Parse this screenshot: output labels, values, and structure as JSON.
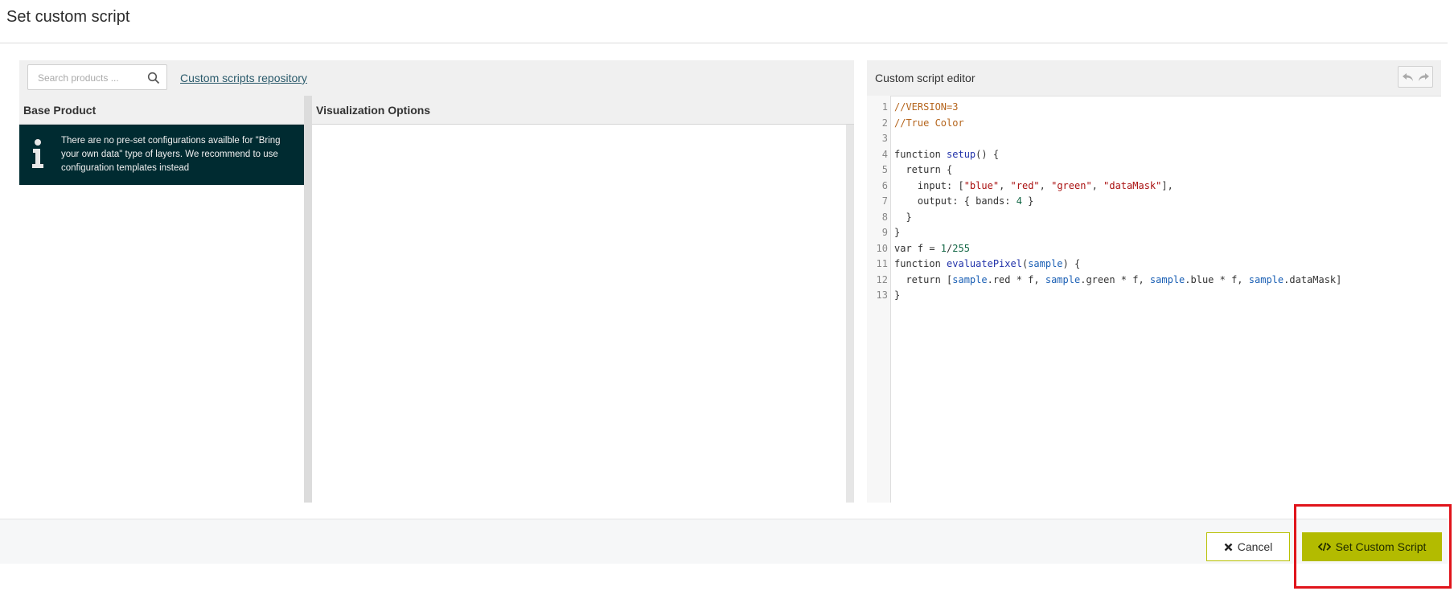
{
  "dialog": {
    "title": "Set custom script"
  },
  "left": {
    "search": {
      "placeholder": "Search products ..."
    },
    "repo_link": "Custom scripts repository",
    "columns": {
      "base_product": "Base Product",
      "visualization": "Visualization Options"
    },
    "info_message": "There are no pre-set configurations availble for \"Bring your own data\" type of layers. We recommend to use configuration templates instead"
  },
  "editor": {
    "title": "Custom script editor",
    "lines": [
      "//VERSION=3",
      "//True Color",
      "",
      "function setup() {",
      "  return {",
      "    input: [\"blue\", \"red\", \"green\", \"dataMask\"],",
      "    output: { bands: 4 }",
      "  }",
      "}",
      "var f = 1/255",
      "function evaluatePixel(sample) {",
      "  return [sample.red * f, sample.green * f, sample.blue * f, sample.dataMask]",
      "}"
    ],
    "line_numbers": [
      "1",
      "2",
      "3",
      "4",
      "5",
      "6",
      "7",
      "8",
      "9",
      "10",
      "11",
      "12",
      "13"
    ]
  },
  "footer": {
    "cancel_label": "Cancel",
    "set_label": "Set Custom Script"
  },
  "colors": {
    "accent": "#b3bb00",
    "info_bg": "#002b31",
    "highlight": "#e0141b"
  },
  "icons": [
    "search-icon",
    "info-icon",
    "undo-icon",
    "redo-icon",
    "close-icon",
    "code-icon"
  ]
}
